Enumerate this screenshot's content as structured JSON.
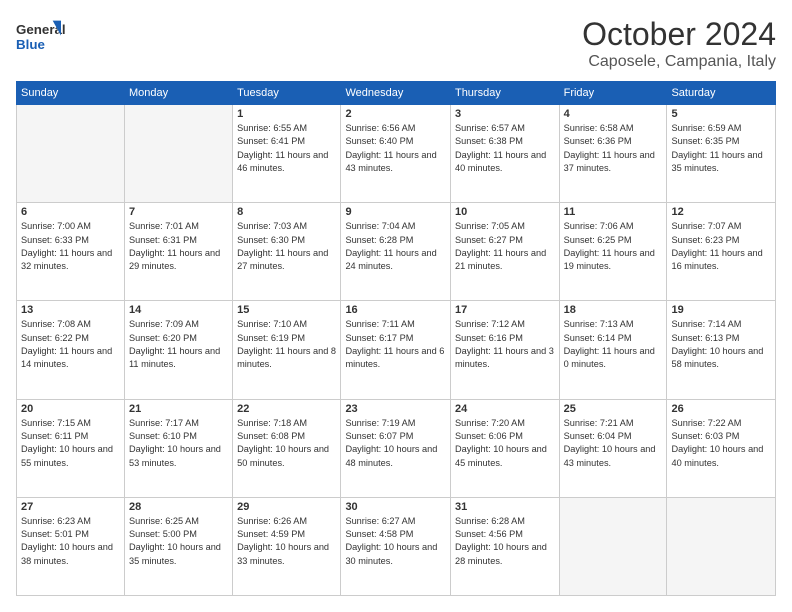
{
  "header": {
    "logo_line1": "General",
    "logo_line2": "Blue",
    "month": "October 2024",
    "location": "Caposele, Campania, Italy"
  },
  "days_of_week": [
    "Sunday",
    "Monday",
    "Tuesday",
    "Wednesday",
    "Thursday",
    "Friday",
    "Saturday"
  ],
  "weeks": [
    [
      {
        "day": "",
        "sunrise": "",
        "sunset": "",
        "daylight": ""
      },
      {
        "day": "",
        "sunrise": "",
        "sunset": "",
        "daylight": ""
      },
      {
        "day": "1",
        "sunrise": "Sunrise: 6:55 AM",
        "sunset": "Sunset: 6:41 PM",
        "daylight": "Daylight: 11 hours and 46 minutes."
      },
      {
        "day": "2",
        "sunrise": "Sunrise: 6:56 AM",
        "sunset": "Sunset: 6:40 PM",
        "daylight": "Daylight: 11 hours and 43 minutes."
      },
      {
        "day": "3",
        "sunrise": "Sunrise: 6:57 AM",
        "sunset": "Sunset: 6:38 PM",
        "daylight": "Daylight: 11 hours and 40 minutes."
      },
      {
        "day": "4",
        "sunrise": "Sunrise: 6:58 AM",
        "sunset": "Sunset: 6:36 PM",
        "daylight": "Daylight: 11 hours and 37 minutes."
      },
      {
        "day": "5",
        "sunrise": "Sunrise: 6:59 AM",
        "sunset": "Sunset: 6:35 PM",
        "daylight": "Daylight: 11 hours and 35 minutes."
      }
    ],
    [
      {
        "day": "6",
        "sunrise": "Sunrise: 7:00 AM",
        "sunset": "Sunset: 6:33 PM",
        "daylight": "Daylight: 11 hours and 32 minutes."
      },
      {
        "day": "7",
        "sunrise": "Sunrise: 7:01 AM",
        "sunset": "Sunset: 6:31 PM",
        "daylight": "Daylight: 11 hours and 29 minutes."
      },
      {
        "day": "8",
        "sunrise": "Sunrise: 7:03 AM",
        "sunset": "Sunset: 6:30 PM",
        "daylight": "Daylight: 11 hours and 27 minutes."
      },
      {
        "day": "9",
        "sunrise": "Sunrise: 7:04 AM",
        "sunset": "Sunset: 6:28 PM",
        "daylight": "Daylight: 11 hours and 24 minutes."
      },
      {
        "day": "10",
        "sunrise": "Sunrise: 7:05 AM",
        "sunset": "Sunset: 6:27 PM",
        "daylight": "Daylight: 11 hours and 21 minutes."
      },
      {
        "day": "11",
        "sunrise": "Sunrise: 7:06 AM",
        "sunset": "Sunset: 6:25 PM",
        "daylight": "Daylight: 11 hours and 19 minutes."
      },
      {
        "day": "12",
        "sunrise": "Sunrise: 7:07 AM",
        "sunset": "Sunset: 6:23 PM",
        "daylight": "Daylight: 11 hours and 16 minutes."
      }
    ],
    [
      {
        "day": "13",
        "sunrise": "Sunrise: 7:08 AM",
        "sunset": "Sunset: 6:22 PM",
        "daylight": "Daylight: 11 hours and 14 minutes."
      },
      {
        "day": "14",
        "sunrise": "Sunrise: 7:09 AM",
        "sunset": "Sunset: 6:20 PM",
        "daylight": "Daylight: 11 hours and 11 minutes."
      },
      {
        "day": "15",
        "sunrise": "Sunrise: 7:10 AM",
        "sunset": "Sunset: 6:19 PM",
        "daylight": "Daylight: 11 hours and 8 minutes."
      },
      {
        "day": "16",
        "sunrise": "Sunrise: 7:11 AM",
        "sunset": "Sunset: 6:17 PM",
        "daylight": "Daylight: 11 hours and 6 minutes."
      },
      {
        "day": "17",
        "sunrise": "Sunrise: 7:12 AM",
        "sunset": "Sunset: 6:16 PM",
        "daylight": "Daylight: 11 hours and 3 minutes."
      },
      {
        "day": "18",
        "sunrise": "Sunrise: 7:13 AM",
        "sunset": "Sunset: 6:14 PM",
        "daylight": "Daylight: 11 hours and 0 minutes."
      },
      {
        "day": "19",
        "sunrise": "Sunrise: 7:14 AM",
        "sunset": "Sunset: 6:13 PM",
        "daylight": "Daylight: 10 hours and 58 minutes."
      }
    ],
    [
      {
        "day": "20",
        "sunrise": "Sunrise: 7:15 AM",
        "sunset": "Sunset: 6:11 PM",
        "daylight": "Daylight: 10 hours and 55 minutes."
      },
      {
        "day": "21",
        "sunrise": "Sunrise: 7:17 AM",
        "sunset": "Sunset: 6:10 PM",
        "daylight": "Daylight: 10 hours and 53 minutes."
      },
      {
        "day": "22",
        "sunrise": "Sunrise: 7:18 AM",
        "sunset": "Sunset: 6:08 PM",
        "daylight": "Daylight: 10 hours and 50 minutes."
      },
      {
        "day": "23",
        "sunrise": "Sunrise: 7:19 AM",
        "sunset": "Sunset: 6:07 PM",
        "daylight": "Daylight: 10 hours and 48 minutes."
      },
      {
        "day": "24",
        "sunrise": "Sunrise: 7:20 AM",
        "sunset": "Sunset: 6:06 PM",
        "daylight": "Daylight: 10 hours and 45 minutes."
      },
      {
        "day": "25",
        "sunrise": "Sunrise: 7:21 AM",
        "sunset": "Sunset: 6:04 PM",
        "daylight": "Daylight: 10 hours and 43 minutes."
      },
      {
        "day": "26",
        "sunrise": "Sunrise: 7:22 AM",
        "sunset": "Sunset: 6:03 PM",
        "daylight": "Daylight: 10 hours and 40 minutes."
      }
    ],
    [
      {
        "day": "27",
        "sunrise": "Sunrise: 6:23 AM",
        "sunset": "Sunset: 5:01 PM",
        "daylight": "Daylight: 10 hours and 38 minutes."
      },
      {
        "day": "28",
        "sunrise": "Sunrise: 6:25 AM",
        "sunset": "Sunset: 5:00 PM",
        "daylight": "Daylight: 10 hours and 35 minutes."
      },
      {
        "day": "29",
        "sunrise": "Sunrise: 6:26 AM",
        "sunset": "Sunset: 4:59 PM",
        "daylight": "Daylight: 10 hours and 33 minutes."
      },
      {
        "day": "30",
        "sunrise": "Sunrise: 6:27 AM",
        "sunset": "Sunset: 4:58 PM",
        "daylight": "Daylight: 10 hours and 30 minutes."
      },
      {
        "day": "31",
        "sunrise": "Sunrise: 6:28 AM",
        "sunset": "Sunset: 4:56 PM",
        "daylight": "Daylight: 10 hours and 28 minutes."
      },
      {
        "day": "",
        "sunrise": "",
        "sunset": "",
        "daylight": ""
      },
      {
        "day": "",
        "sunrise": "",
        "sunset": "",
        "daylight": ""
      }
    ]
  ]
}
